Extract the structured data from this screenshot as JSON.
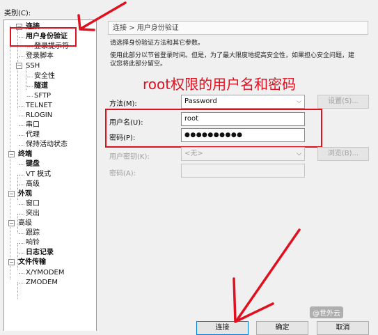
{
  "category_label": "类别(C):",
  "tree": [
    {
      "label": "连接",
      "bold": true
    },
    {
      "label": "用户身份验证",
      "bold": true
    },
    {
      "label": "登录提示符",
      "bold": false
    },
    {
      "label": "登录脚本",
      "bold": false
    },
    {
      "label": "SSH",
      "bold": false
    },
    {
      "label": "安全性",
      "bold": false
    },
    {
      "label": "隧道",
      "bold": true
    },
    {
      "label": "SFTP",
      "bold": false
    },
    {
      "label": "TELNET",
      "bold": false
    },
    {
      "label": "RLOGIN",
      "bold": false
    },
    {
      "label": "串口",
      "bold": false
    },
    {
      "label": "代理",
      "bold": false
    },
    {
      "label": "保持活动状态",
      "bold": false
    },
    {
      "label": "终端",
      "bold": true
    },
    {
      "label": "键盘",
      "bold": true
    },
    {
      "label": "VT 模式",
      "bold": false
    },
    {
      "label": "高级",
      "bold": false
    },
    {
      "label": "外观",
      "bold": true
    },
    {
      "label": "窗口",
      "bold": false
    },
    {
      "label": "突出",
      "bold": false
    },
    {
      "label": "高级",
      "bold": false
    },
    {
      "label": "跟踪",
      "bold": false
    },
    {
      "label": "响铃",
      "bold": false
    },
    {
      "label": "日志记录",
      "bold": true
    },
    {
      "label": "文件传输",
      "bold": true
    },
    {
      "label": "X/YMODEM",
      "bold": false
    },
    {
      "label": "ZMODEM",
      "bold": false
    }
  ],
  "breadcrumb": "连接 > 用户身份验证",
  "description": {
    "line1": "请选择身份验证方法和其它参数。",
    "line2": "使用此部分以节省登录时间。但是，为了最大限度地提高安全性，如果担心安全问题，建",
    "line3": "议您将此部分留空。"
  },
  "annotation": "root权限的用户名和密码",
  "form": {
    "method_label": "方法(M):",
    "method_value": "Password",
    "settings_button": "设置(S)...",
    "username_label": "用户名(U):",
    "username_value": "root",
    "password_label": "密码(P):",
    "password_value": "●●●●●●●●●●",
    "user_key_label": "用户密钥(K):",
    "user_key_value": "<无>",
    "browse_button": "浏览(B)...",
    "passphrase_label": "密码(A):"
  },
  "buttons": {
    "connect": "连接",
    "ok": "确定",
    "cancel": "取消"
  },
  "watermark": "@世外云",
  "colors": {
    "accent_red": "#e0101e"
  }
}
